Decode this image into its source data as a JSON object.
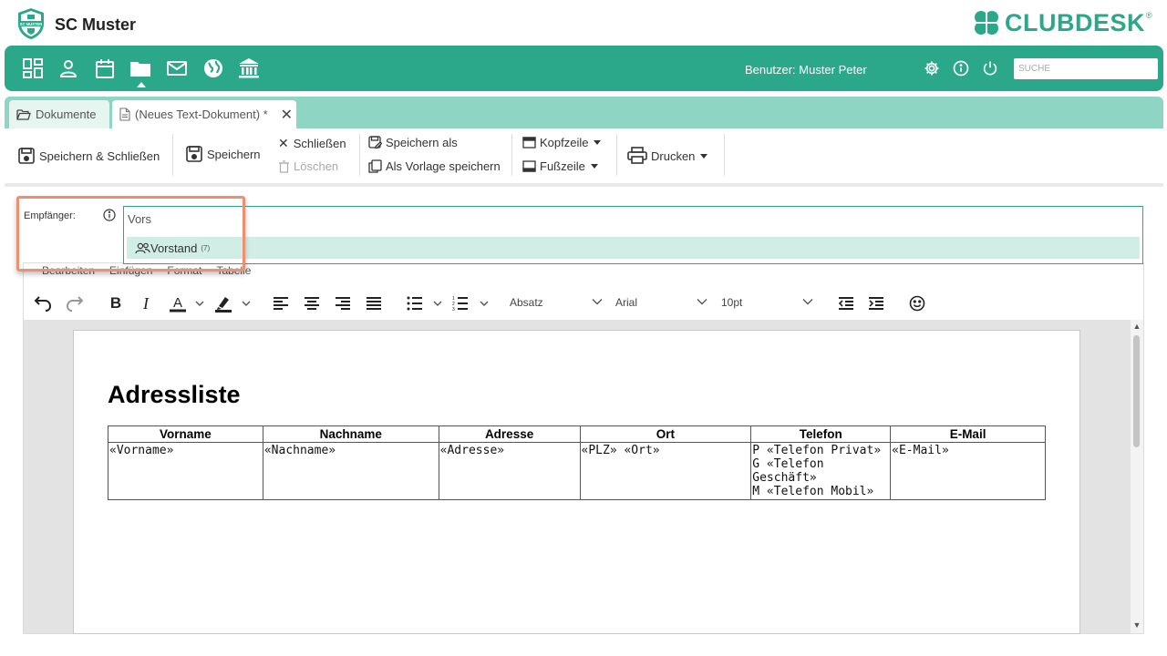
{
  "header": {
    "club_name": "SC Muster",
    "logo_text": "SC MUSTER",
    "brand": "CLUBDESK",
    "brand_mark": "®"
  },
  "nav": {
    "items": [
      "dashboard",
      "members",
      "calendar",
      "documents",
      "mail",
      "website",
      "finance"
    ],
    "active": "documents",
    "user_label": "Benutzer: Muster Peter",
    "search_placeholder": "SUCHE"
  },
  "tabs": [
    {
      "label": "Dokumente",
      "icon": "folder-open-icon"
    },
    {
      "label": "(Neues Text-Dokument) *",
      "icon": "file-icon",
      "active": true
    }
  ],
  "toolbar": {
    "save_close": "Speichern & Schließen",
    "save": "Speichern",
    "close": "Schließen",
    "delete": "Löschen",
    "save_as": "Speichern als",
    "save_template": "Als Vorlage speichern",
    "header": "Kopfzeile",
    "footer": "Fußzeile",
    "print": "Drucken"
  },
  "recipient": {
    "label": "Empfänger:",
    "input_value": "Vors",
    "suggestion_label": "Vorstand",
    "suggestion_count": "(7)"
  },
  "editor": {
    "menu": [
      "Bearbeiten",
      "Einfügen",
      "Format",
      "Tabelle"
    ],
    "block_format": "Absatz",
    "font_family": "Arial",
    "font_size": "10pt"
  },
  "document": {
    "title": "Adressliste",
    "columns": [
      "Vorname",
      "Nachname",
      "Adresse",
      "Ort",
      "Telefon",
      "E-Mail"
    ],
    "row": [
      "«Vorname»",
      "«Nachname»",
      "«Adresse»",
      "«PLZ» «Ort»",
      "P «Telefon Privat»\nG «Telefon Geschäft»\nM «Telefon Mobil»",
      "«E-Mail»"
    ]
  },
  "colors": {
    "accent": "#2aa889",
    "tab_strip": "#8fd5c3",
    "highlight": "#ef8f6f"
  }
}
